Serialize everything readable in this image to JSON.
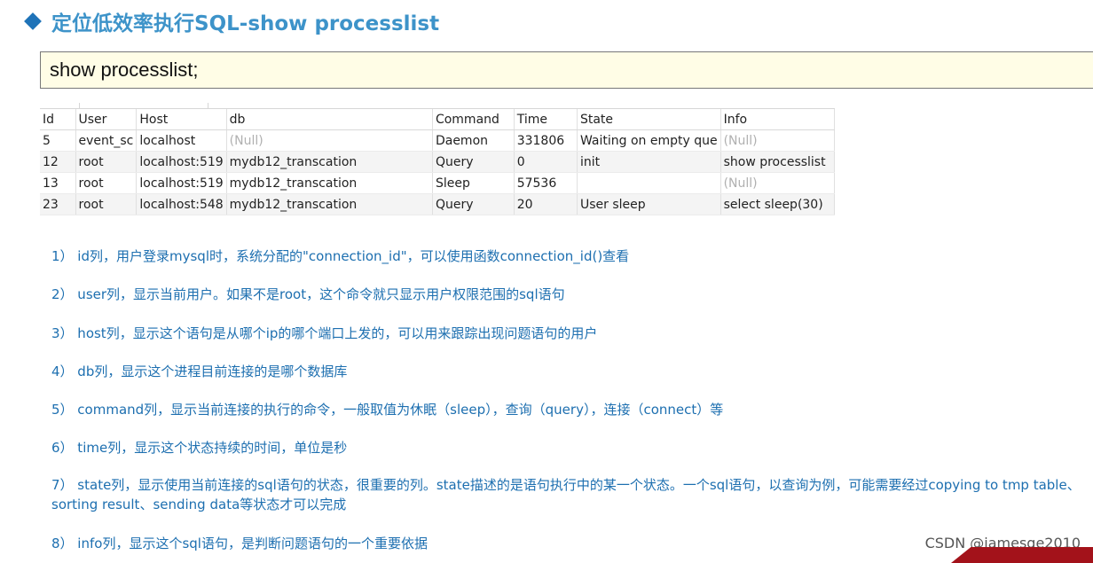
{
  "slide": {
    "title": "定位低效率执行SQL-show processlist",
    "command": "show processlist;"
  },
  "result_grid": {
    "columns": [
      "Id",
      "User",
      "Host",
      "db",
      "Command",
      "Time",
      "State",
      "Info"
    ],
    "rows": [
      [
        "5",
        "event_sc",
        "localhost",
        "(Null)",
        "Daemon",
        "331806",
        "Waiting on empty que",
        "(Null)"
      ],
      [
        "12",
        "root",
        "localhost:519",
        "mydb12_transcation",
        "Query",
        "0",
        "init",
        "show processlist"
      ],
      [
        "13",
        "root",
        "localhost:519",
        "mydb12_transcation",
        "Sleep",
        "57536",
        "",
        "(Null)"
      ],
      [
        "23",
        "root",
        "localhost:548",
        "mydb12_transcation",
        "Query",
        "20",
        "User sleep",
        "select sleep(30)"
      ]
    ]
  },
  "notes": [
    "1） id列，用户登录mysql时，系统分配的\"connection_id\"，可以使用函数connection_id()查看",
    "2） user列，显示当前用户。如果不是root，这个命令就只显示用户权限范围的sql语句",
    "3） host列，显示这个语句是从哪个ip的哪个端口上发的，可以用来跟踪出现问题语句的用户",
    "4） db列，显示这个进程目前连接的是哪个数据库",
    "5） command列，显示当前连接的执行的命令，一般取值为休眠（sleep），查询（query），连接（connect）等",
    "6） time列，显示这个状态持续的时间，单位是秒",
    "7） state列，显示使用当前连接的sql语句的状态，很重要的列。state描述的是语句执行中的某一个状态。一个sql语句，以查询为例，可能需要经过copying to tmp table、sorting result、sending data等状态才可以完成",
    "8） info列，显示这个sql语句，是判断问题语句的一个重要依据"
  ],
  "watermark": "CSDN @jamesge2010",
  "colors": {
    "title": "#3d93c9",
    "notes": "#1d6fb0",
    "command_box": "#fffde6",
    "corner": "#a3121a"
  }
}
